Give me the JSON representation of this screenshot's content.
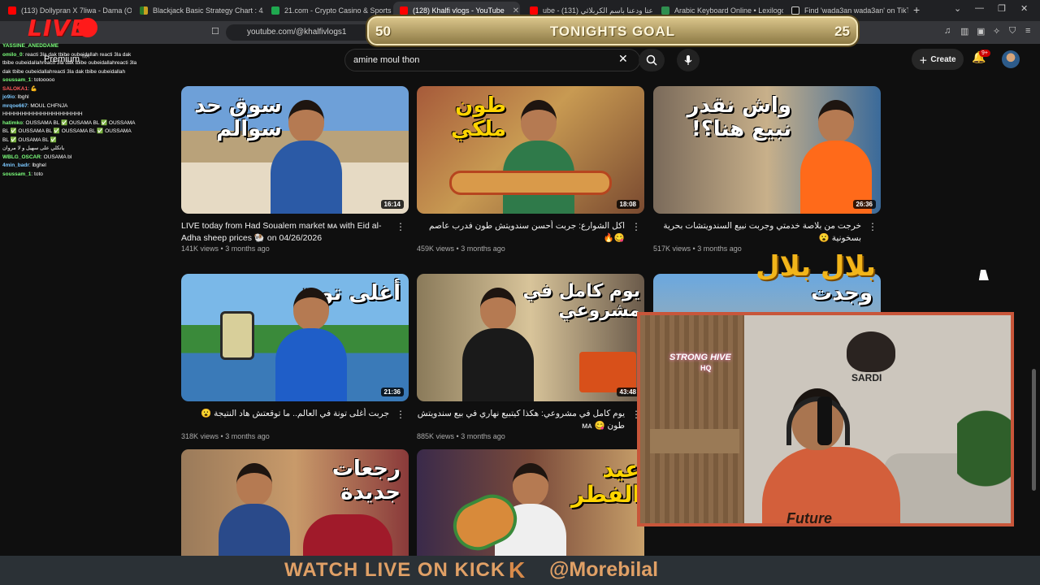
{
  "browser": {
    "tabs": [
      {
        "label": "(113) Dollypran X 7liwa - Dama (Off",
        "favicon": "yt",
        "active": false
      },
      {
        "label": "Blackjack Basic Strategy Chart : 4/6/",
        "favicon": "bj",
        "active": false
      },
      {
        "label": "21.com - Crypto Casino & Sports B",
        "favicon": "cs",
        "active": false
      },
      {
        "label": "(128) Khalfi vlogs - YouTube",
        "favicon": "yt",
        "active": true
      },
      {
        "label": "ube - ودعتا ودعنا باسم الكربلائي (131)",
        "favicon": "yt",
        "active": false
      },
      {
        "label": "Arabic Keyboard Online • Lexilogos",
        "favicon": "lx",
        "active": false
      },
      {
        "label": "Find 'wada3an wada3an' on TikTok |",
        "favicon": "tt",
        "active": false
      }
    ],
    "url": "youtube.com/@khalfivlogs1"
  },
  "youtube": {
    "search_query": "amine moul thon",
    "premium_label": "Premium",
    "region_badge": "MA",
    "create_label": "Create",
    "notification_count": "9+",
    "videos": [
      {
        "title": "LIVE today from Had Soualem market ᴍᴀ with Eid al-Adha sheep prices 🐏 on 04/26/2026",
        "views": "141K views",
        "age": "3 months ago",
        "duration": "16:14",
        "thumb_text": "سوق حد سوالم",
        "thumb_text_color": "white",
        "rtl": false
      },
      {
        "title": "اكل الشوارع: جربت أحسن سندويتش طون فدرب عاصم 😋🔥",
        "views": "459K views",
        "age": "3 months ago",
        "duration": "18:08",
        "thumb_text": "طون ملكي",
        "thumb_text_color": "yellow",
        "rtl": true
      },
      {
        "title": "خرجت من بلاصة خدمتي وجربت نبيع السندويتشات بحرية بسخونية 😮",
        "views": "517K views",
        "age": "3 months ago",
        "duration": "26:36",
        "thumb_text": "واش نقدر نبيع هنا؟!",
        "thumb_text_color": "white",
        "rtl": true
      },
      {
        "title": "جربت أغلى تونة في العالم.. ما توقعتش هاد النتيجة 😮",
        "views": "318K views",
        "age": "3 months ago",
        "duration": "21:36",
        "thumb_text": "أغلى تونة",
        "thumb_text_color": "white",
        "rtl": true
      },
      {
        "title": "يوم كامل في مشروعي: هكذا كيتبيع نهاري في بيع سندويتش طون 😋 ᴍᴀ",
        "views": "885K views",
        "age": "3 months ago",
        "duration": "43:48",
        "thumb_text": "يوم كامل في مشروعي",
        "thumb_text_color": "white",
        "rtl": true
      },
      {
        "title": "",
        "views": "",
        "age": "",
        "duration": "",
        "thumb_text": "وجدت",
        "thumb_text_color": "white",
        "rtl": true
      },
      {
        "title": "",
        "views": "",
        "age": "",
        "duration": "",
        "thumb_text": "رجعات جديدة",
        "thumb_text_color": "white",
        "rtl": true
      },
      {
        "title": "",
        "views": "",
        "age": "",
        "duration": "",
        "thumb_text": "عيد الفطر",
        "thumb_text_color": "yellow",
        "rtl": true
      }
    ]
  },
  "chat": [
    {
      "user": "YASSINE_ANEDDAME",
      "msg": "",
      "color": "#7cff7c"
    },
    {
      "user": "omilo_0",
      "msg": ": reacti 3la dak tbibe oubeidallah reacti 3la dak tbibe oubeidallahreacti 3la dak tbibe oubeidallahreacti 3la dak tbibe oubeidallahreacti 3la dak tbibe oubeidallah",
      "color": "#7cff7c"
    },
    {
      "user": "soussam_1",
      "msg": ": totooooo",
      "color": "#7cff7c"
    },
    {
      "user": "SALOKA1",
      "msg": ": 💪",
      "color": "#ff5a5a"
    },
    {
      "user": "jo9io",
      "msg": ": lbghl",
      "color": "#7cc8ff"
    },
    {
      "user": "mrqoe667",
      "msg": ": MOUL CHFNJA HHHHHHHHHHHHHHHHHHHHH",
      "color": "#7cc8ff"
    },
    {
      "user": "hatimko",
      "msg": ": OUSSAMA BL ✅ OUSAMA BL ✅ OUSSAMA BL ✅ OUSSAMA BL ✅ OUSSAMA BL ✅ OUSSAMA BL ✅ OUSAMA BL ✅",
      "color": "#7cff7c"
    },
    {
      "user": "",
      "msg": "ياتكلي على سهيل و لا مروان",
      "color": "#ffffff"
    },
    {
      "user": "WBLG_OSCAR",
      "msg": ": OUSAMA bl",
      "color": "#7cff7c"
    },
    {
      "user": "4min_badr",
      "msg": ": lbghel",
      "color": "#7cc8ff"
    },
    {
      "user": "soussam_1",
      "msg": ": toto",
      "color": "#7cff7c"
    }
  ],
  "stream": {
    "live_label": "LIVE",
    "goal": {
      "title": "TONIGHTS GOAL",
      "current": "50",
      "target": "25"
    },
    "cam": {
      "neon_text": "STRONG HIVE",
      "neon_sub": "HQ",
      "logo_text": "SARDI",
      "shirt_text": "Future"
    },
    "overlay_arabic": "بلال بلال",
    "banner": {
      "text": "WATCH LIVE ON KICK",
      "k": "K",
      "handle": "@Morebilal"
    }
  }
}
